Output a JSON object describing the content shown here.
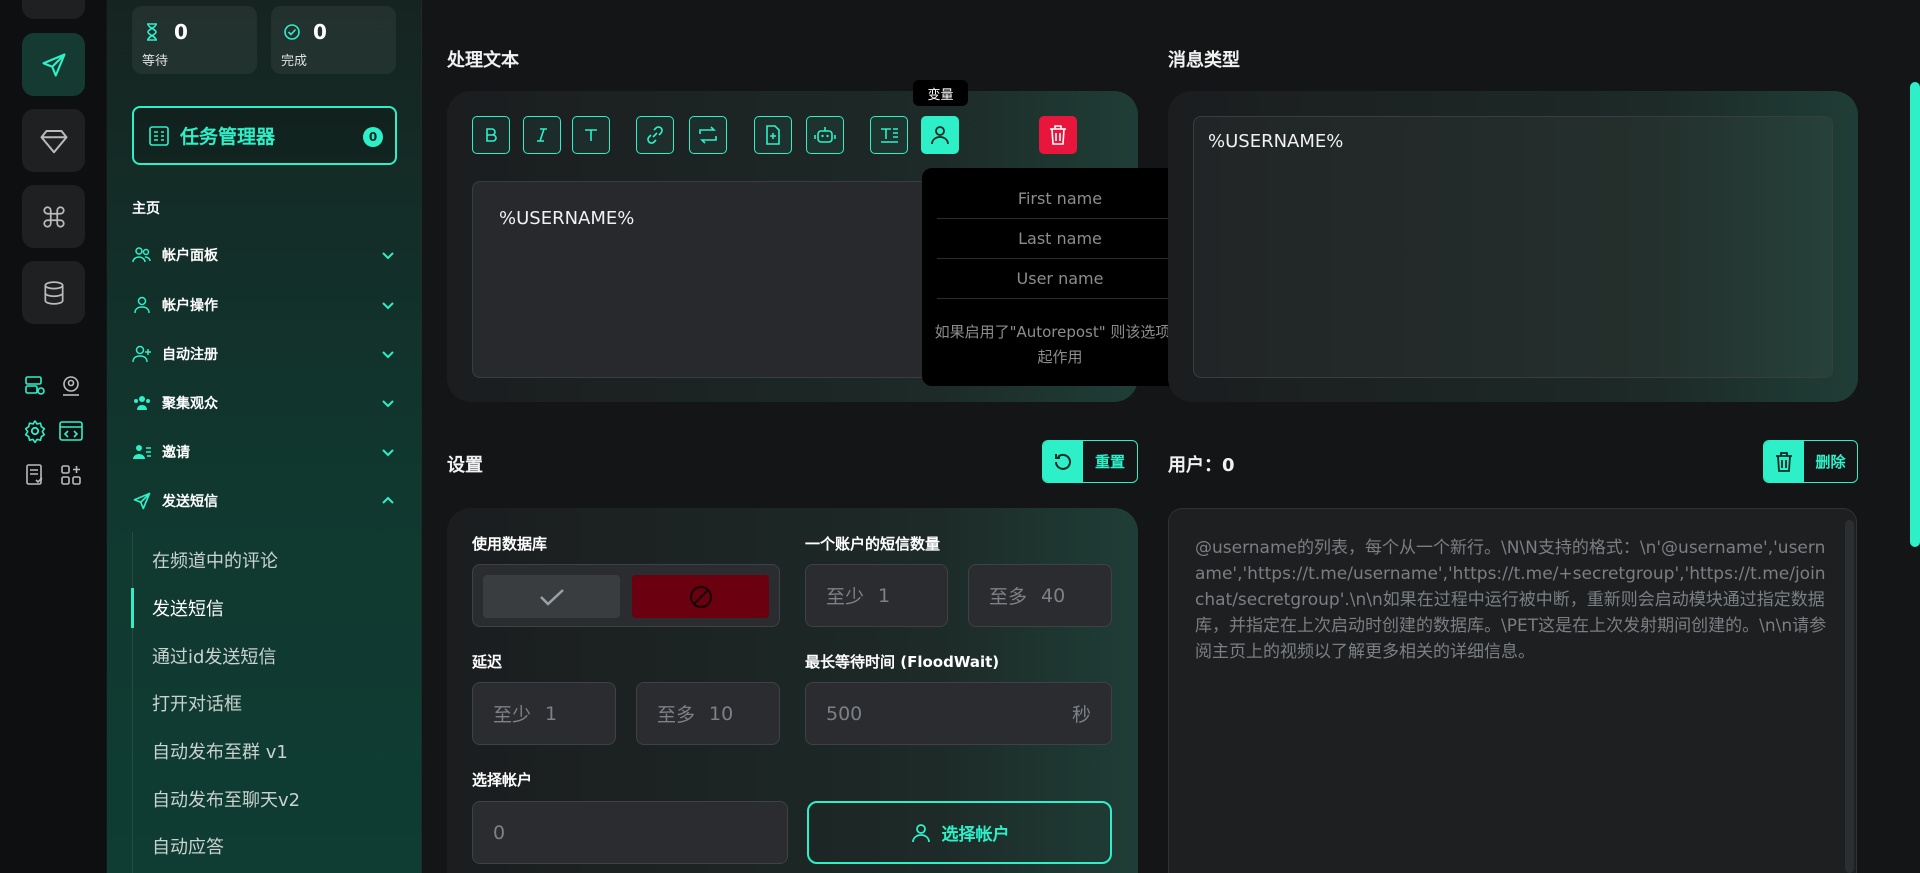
{
  "colors": {
    "accent": "#2ef0c8",
    "danger": "#e8163c",
    "bg": "#131517"
  },
  "stats": [
    {
      "value": "0",
      "label": "等待",
      "icon": "hourglass-icon"
    },
    {
      "value": "0",
      "label": "完成",
      "icon": "check-circle-icon"
    }
  ],
  "task_manager": {
    "label": "任务管理器",
    "badge": "0"
  },
  "nav": {
    "home": "主页",
    "items": [
      {
        "label": "帐户面板",
        "icon": "users-icon"
      },
      {
        "label": "帐户操作",
        "icon": "user-icon"
      },
      {
        "label": "自动注册",
        "icon": "user-plus-icon"
      },
      {
        "label": "聚集观众",
        "icon": "users-group-icon"
      },
      {
        "label": "邀请",
        "icon": "user-list-icon"
      },
      {
        "label": "发送短信",
        "icon": "send-icon"
      }
    ],
    "sub_items": [
      "在频道中的评论",
      "发送短信",
      "通过id发送短信",
      "打开对话框",
      "自动发布至群 v1",
      "自动发布至聊天v2",
      "自动应答"
    ]
  },
  "process_text": {
    "title": "处理文本",
    "editor_value": "%USERNAME%",
    "tooltip": "变量",
    "toolbar": [
      "bold-icon",
      "italic-icon",
      "text-icon",
      "link-icon",
      "repost-icon",
      "file-add-icon",
      "bot-icon",
      "text-format-icon",
      "variable-user-icon",
      "trash-icon"
    ],
    "dropdown": {
      "options": [
        "First name",
        "Last name",
        "User name"
      ],
      "note": "如果启用了\"Autorepost\" 则该选项不起作用"
    }
  },
  "message_type": {
    "title": "消息类型",
    "value": "%USERNAME%"
  },
  "settings": {
    "title": "设置",
    "reset_label": "重置",
    "use_database_label": "使用数据库",
    "sms_count_label": "一个账户的短信数量",
    "sms_min": {
      "prefix": "至少",
      "value": "1"
    },
    "sms_max": {
      "prefix": "至多",
      "value": "40"
    },
    "delay_label": "延迟",
    "delay_min": {
      "prefix": "至少",
      "value": "1"
    },
    "delay_max": {
      "prefix": "至多",
      "value": "10"
    },
    "floodwait_label": "最长等待时间 (FloodWait)",
    "floodwait_value": "500",
    "floodwait_unit": "秒",
    "select_account_label": "选择帐户",
    "account_value": "0",
    "select_account_button": "选择帐户"
  },
  "users": {
    "title": "用户：0",
    "delete_label": "删除",
    "placeholder": "@username的列表，每个从一个新行。\\N\\N支持的格式：\\n'@username','username','https://t.me/username','https://t.me/+secretgroup','https://t.me/joinchat/secretgroup'.\\n\\n如果在过程中运行被中断，重新则会启动模块通过指定数据库，并指定在上次启动时创建的数据库。\\PET这是在上次发射期间创建的。\\n\\n请参阅主页上的视频以了解更多相关的详细信息。"
  }
}
